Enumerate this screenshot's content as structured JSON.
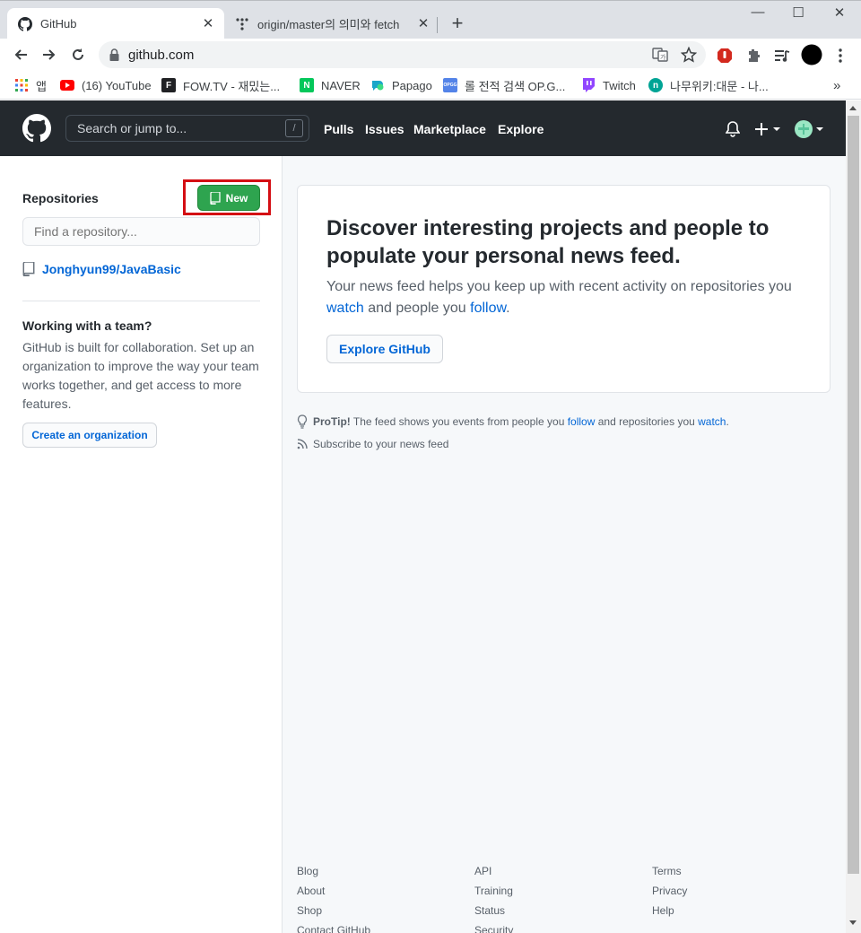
{
  "browser": {
    "tabs": [
      {
        "title": "GitHub",
        "icon": "github-icon"
      },
      {
        "title": "origin/master의 의미와 fetch",
        "icon": "tistory-icon"
      }
    ],
    "url": "github.com",
    "bookmarks": [
      {
        "label": "앱",
        "icon": "apps-grid-icon"
      },
      {
        "label": "(16) YouTube",
        "icon": "youtube-icon",
        "color": "#ff0000"
      },
      {
        "label": "FOW.TV - 재밌는...",
        "icon": "fowtv-icon",
        "color": "#202124"
      },
      {
        "label": "NAVER",
        "icon": "naver-icon",
        "color": "#03c75a"
      },
      {
        "label": "Papago",
        "icon": "papago-icon",
        "color": "#1aa6c9"
      },
      {
        "label": "롤 전적 검색 OP.G...",
        "icon": "opgg-icon",
        "color": "#5383e8"
      },
      {
        "label": "Twitch",
        "icon": "twitch-icon",
        "color": "#9146ff"
      },
      {
        "label": "나무위키:대문 - 나...",
        "icon": "namuwiki-icon",
        "color": "#00a495"
      }
    ]
  },
  "header": {
    "search_placeholder": "Search or jump to...",
    "slash_key": "/",
    "nav": [
      "Pulls",
      "Issues",
      "Marketplace",
      "Explore"
    ]
  },
  "sidebar": {
    "repositories_title": "Repositories",
    "new_button": "New",
    "find_placeholder": "Find a repository...",
    "repos": [
      "Jonghyun99/JavaBasic"
    ],
    "team_title": "Working with a team?",
    "team_text": "GitHub is built for collaboration. Set up an organization to improve the way your team works together, and get access to more features.",
    "create_org": "Create an organization"
  },
  "feed": {
    "heading": "Discover interesting projects and people to populate your personal news feed.",
    "text_before": "Your news feed helps you keep up with recent activity on repositories you ",
    "watch": "watch",
    "text_middle": " and people you ",
    "follow": "follow",
    "text_end": ".",
    "explore_button": "Explore GitHub",
    "protip_label": "ProTip!",
    "protip_before": " The feed shows you events from people you ",
    "protip_follow": "follow",
    "protip_middle": " and repositories you ",
    "protip_watch": "watch",
    "protip_end": ".",
    "subscribe": "Subscribe to your news feed"
  },
  "footer": {
    "col1": [
      "Blog",
      "About",
      "Shop",
      "Contact GitHub"
    ],
    "col2": [
      "API",
      "Training",
      "Status",
      "Security"
    ],
    "col3": [
      "Terms",
      "Privacy",
      "Help"
    ]
  },
  "colors": {
    "header_bg": "#24292e",
    "new_button": "#2ea44f",
    "highlight_box": "#d40e13",
    "link": "#0366d6"
  }
}
